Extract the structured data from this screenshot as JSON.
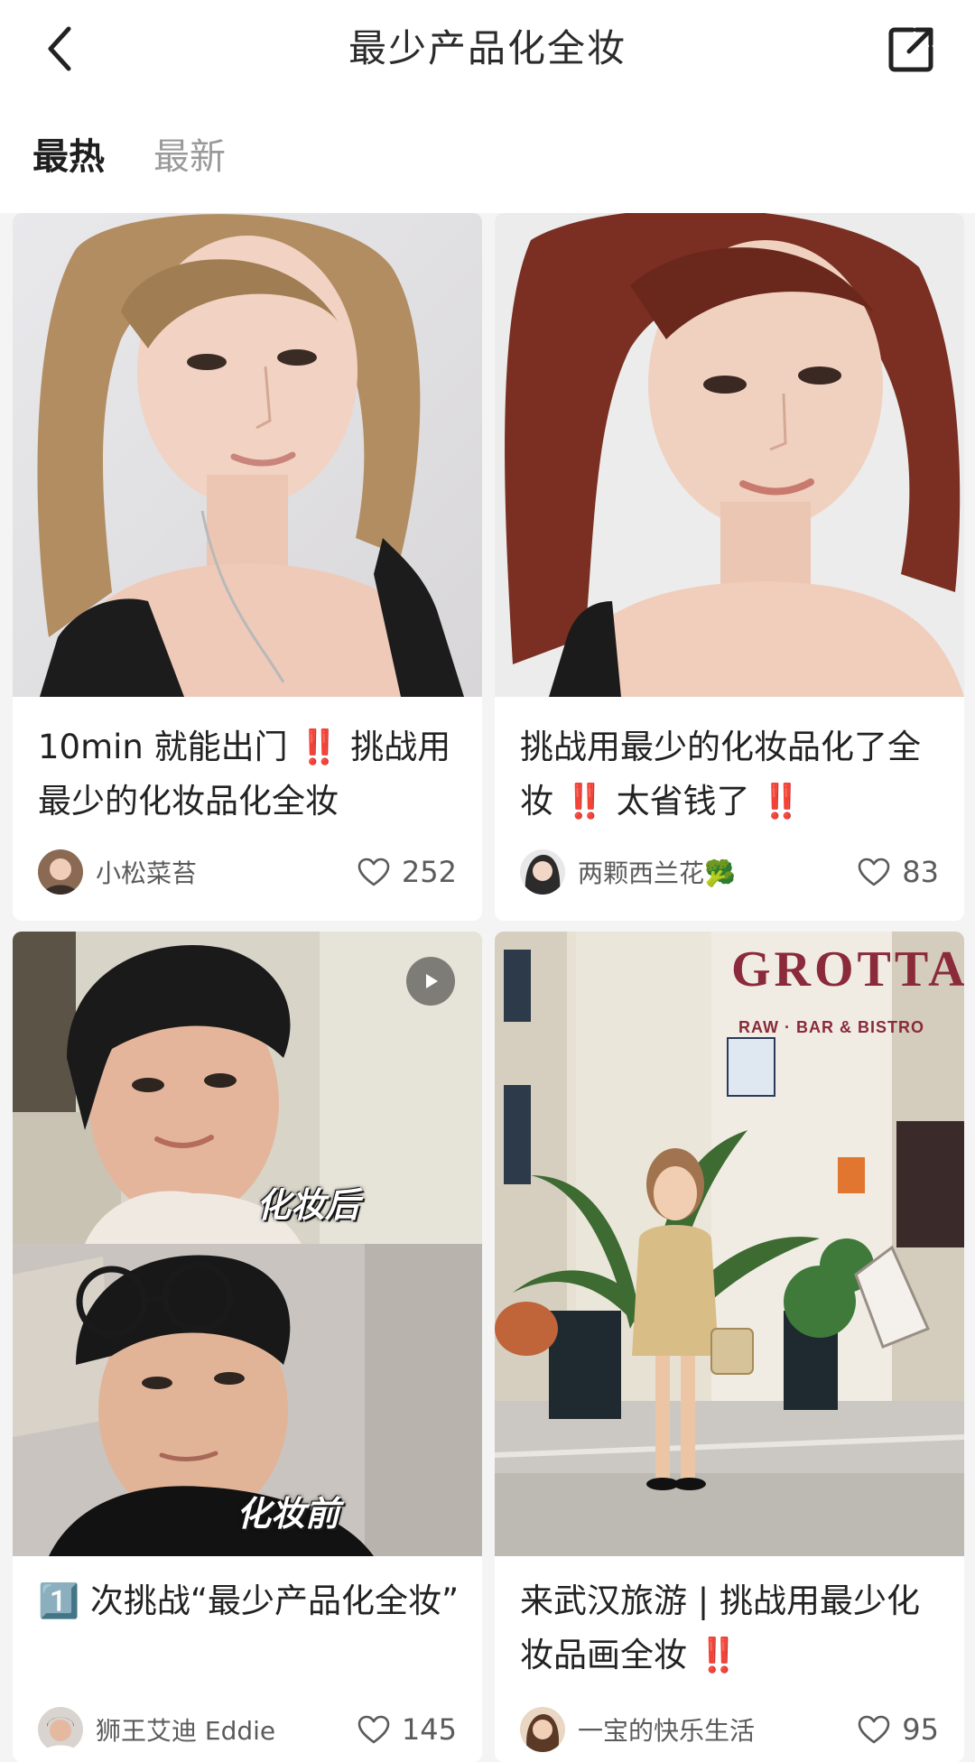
{
  "header": {
    "title": "最少产品化全妆",
    "back_icon": "chevron-left-icon",
    "share_icon": "share-external-icon"
  },
  "tabs": [
    {
      "label": "最热",
      "active": true
    },
    {
      "label": "最新",
      "active": false
    }
  ],
  "cards": [
    {
      "title_parts": [
        "10min 就能出门 ",
        "‼️",
        " 挑战用最少的化妆品化全妆"
      ],
      "author": "小松菜苔",
      "likes": "252"
    },
    {
      "title_parts": [
        "挑战用最少的化妆品化了全妆 ",
        "‼️",
        " 太省钱了 ",
        "‼️"
      ],
      "author": "两颗西兰花🥦",
      "likes": "83"
    },
    {
      "title": "1️⃣ 次挑战“最少产品化全妆”",
      "author": "狮王艾迪 Eddie",
      "likes": "145",
      "labels": {
        "after": "化妆后",
        "before": "化妆前"
      }
    },
    {
      "title_parts": [
        "来武汉旅游 | 挑战用最少化妆品画全妆 ",
        "‼️"
      ],
      "author": "一宝的快乐生活",
      "likes": "95",
      "sign_text": {
        "main": "GROTTA",
        "sub": "RAW · BAR & BISTRO"
      }
    }
  ],
  "colors": {
    "accent_red": "#e3262b",
    "background": "#f4f4f4",
    "card": "#ffffff",
    "text": "#222222",
    "secondary": "#5b5b5b"
  }
}
